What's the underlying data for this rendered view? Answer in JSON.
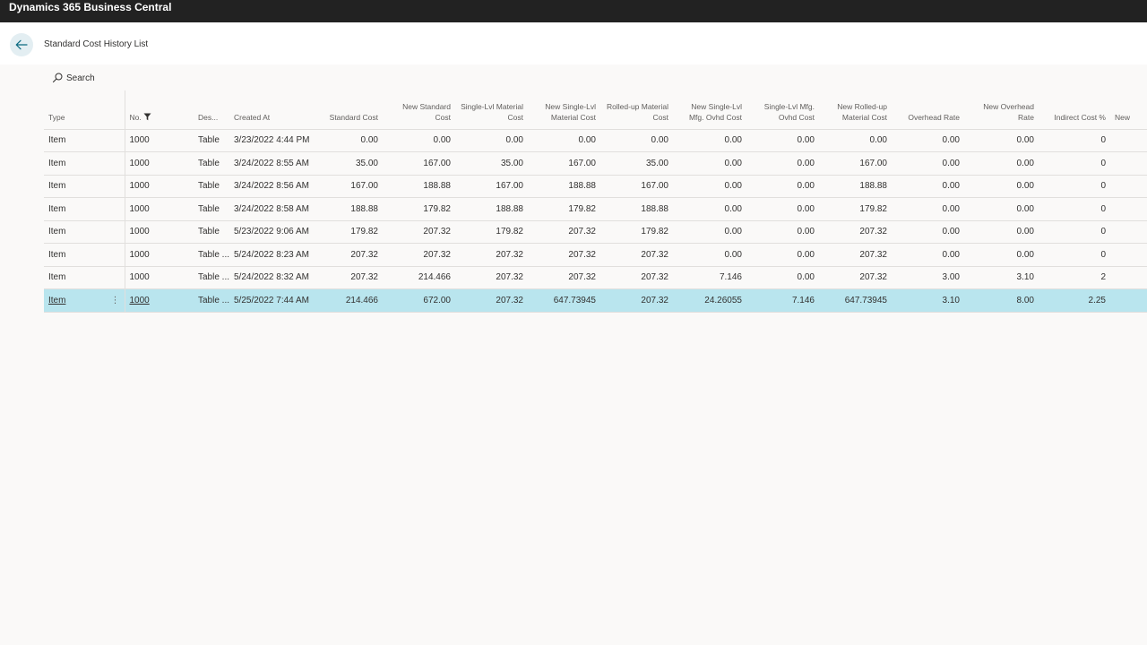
{
  "app": {
    "title": "Dynamics 365 Business Central"
  },
  "page": {
    "title": "Standard Cost History List"
  },
  "search": {
    "label": "Search"
  },
  "columns": [
    {
      "key": "type",
      "label": "Type"
    },
    {
      "key": "no",
      "label": "No."
    },
    {
      "key": "desc",
      "label": "Des..."
    },
    {
      "key": "created",
      "label": "Created At"
    },
    {
      "key": "std",
      "label": "Standard Cost"
    },
    {
      "key": "newstd",
      "label": "New Standard Cost"
    },
    {
      "key": "slmat",
      "label": "Single-Lvl Material Cost"
    },
    {
      "key": "newslmat",
      "label": "New Single-Lvl Material Cost"
    },
    {
      "key": "rumat",
      "label": "Rolled-up Material Cost"
    },
    {
      "key": "newslmfg",
      "label": "New Single-Lvl Mfg. Ovhd Cost"
    },
    {
      "key": "slmfg",
      "label": "Single-Lvl Mfg. Ovhd Cost"
    },
    {
      "key": "newrumat",
      "label": "New Rolled-up Material Cost"
    },
    {
      "key": "ovhd",
      "label": "Overhead Rate"
    },
    {
      "key": "newovhd",
      "label": "New Overhead Rate"
    },
    {
      "key": "indirect",
      "label": "Indirect Cost %"
    },
    {
      "key": "new_trunc",
      "label": "New"
    }
  ],
  "rows": [
    {
      "cells": [
        "Item",
        "1000",
        "Table",
        "3/23/2022 4:44 PM",
        "0.00",
        "0.00",
        "0.00",
        "0.00",
        "0.00",
        "0.00",
        "0.00",
        "0.00",
        "0.00",
        "0.00",
        "0"
      ]
    },
    {
      "cells": [
        "Item",
        "1000",
        "Table",
        "3/24/2022 8:55 AM",
        "35.00",
        "167.00",
        "35.00",
        "167.00",
        "35.00",
        "0.00",
        "0.00",
        "167.00",
        "0.00",
        "0.00",
        "0"
      ]
    },
    {
      "cells": [
        "Item",
        "1000",
        "Table",
        "3/24/2022 8:56 AM",
        "167.00",
        "188.88",
        "167.00",
        "188.88",
        "167.00",
        "0.00",
        "0.00",
        "188.88",
        "0.00",
        "0.00",
        "0"
      ]
    },
    {
      "cells": [
        "Item",
        "1000",
        "Table",
        "3/24/2022 8:58 AM",
        "188.88",
        "179.82",
        "188.88",
        "179.82",
        "188.88",
        "0.00",
        "0.00",
        "179.82",
        "0.00",
        "0.00",
        "0"
      ]
    },
    {
      "cells": [
        "Item",
        "1000",
        "Table",
        "5/23/2022 9:06 AM",
        "179.82",
        "207.32",
        "179.82",
        "207.32",
        "179.82",
        "0.00",
        "0.00",
        "207.32",
        "0.00",
        "0.00",
        "0"
      ]
    },
    {
      "cells": [
        "Item",
        "1000",
        "Table ...",
        "5/24/2022 8:23 AM",
        "207.32",
        "207.32",
        "207.32",
        "207.32",
        "207.32",
        "0.00",
        "0.00",
        "207.32",
        "0.00",
        "0.00",
        "0"
      ]
    },
    {
      "cells": [
        "Item",
        "1000",
        "Table ...",
        "5/24/2022 8:32 AM",
        "207.32",
        "214.466",
        "207.32",
        "207.32",
        "207.32",
        "7.146",
        "0.00",
        "207.32",
        "3.00",
        "3.10",
        "2"
      ]
    },
    {
      "cells": [
        "Item",
        "1000",
        "Table ...",
        "5/25/2022 7:44 AM",
        "214.466",
        "672.00",
        "207.32",
        "647.73945",
        "207.32",
        "24.26055",
        "7.146",
        "647.73945",
        "3.10",
        "8.00",
        "2.25"
      ]
    }
  ],
  "selected_row_index": 7,
  "colors": {
    "topbar": "#222222",
    "selected_row": "#b9e5ee",
    "back_button_bg": "#e3eef2",
    "accent": "#0b6a80"
  },
  "icons": {
    "back": "arrow-left-icon",
    "search": "search-icon",
    "filter": "filter-icon",
    "row_actions": "more-vertical-icon"
  }
}
